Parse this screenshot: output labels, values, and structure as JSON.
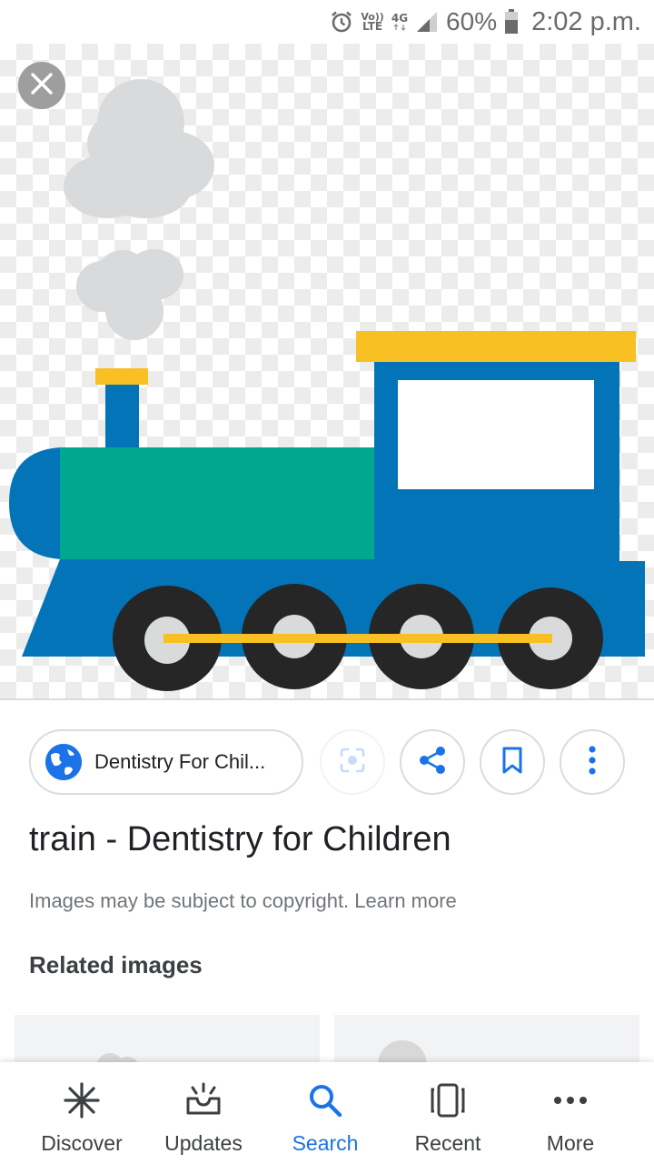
{
  "status_bar": {
    "network_label_top": "Vo))",
    "network_label_bottom": "LTE",
    "network_type": "4G",
    "battery_percent": "60%",
    "time": "2:02 p.m.",
    "icons": [
      "alarm-icon",
      "volte-icon",
      "4g-icon",
      "signal-icon",
      "battery-icon"
    ]
  },
  "viewer": {
    "close_icon": "close-icon",
    "image_subject": "train illustration"
  },
  "source": {
    "icon": "globe-icon",
    "label": "Dentistry For Chil..."
  },
  "actions": [
    {
      "name": "lens-button",
      "icon": "lens-icon"
    },
    {
      "name": "share-button",
      "icon": "share-icon"
    },
    {
      "name": "save-button",
      "icon": "bookmark-icon"
    },
    {
      "name": "more-options-button",
      "icon": "more-vert-icon"
    }
  ],
  "title": "train - Dentistry for Children",
  "copyright_text": "Images may be subject to copyright. Learn more",
  "related_title": "Related images",
  "bottom_nav": {
    "items": [
      {
        "label": "Discover",
        "icon": "asterisk-icon",
        "active": false
      },
      {
        "label": "Updates",
        "icon": "updates-icon",
        "active": false
      },
      {
        "label": "Search",
        "icon": "search-icon",
        "active": true
      },
      {
        "label": "Recent",
        "icon": "recent-icon",
        "active": false
      },
      {
        "label": "More",
        "icon": "more-horiz-icon",
        "active": false
      }
    ]
  },
  "colors": {
    "accent": "#1a73e8",
    "train_blue": "#0474b8",
    "train_teal": "#00a890",
    "train_yellow": "#f9c023",
    "wheel": "#262626",
    "smoke": "#d9dadb"
  }
}
